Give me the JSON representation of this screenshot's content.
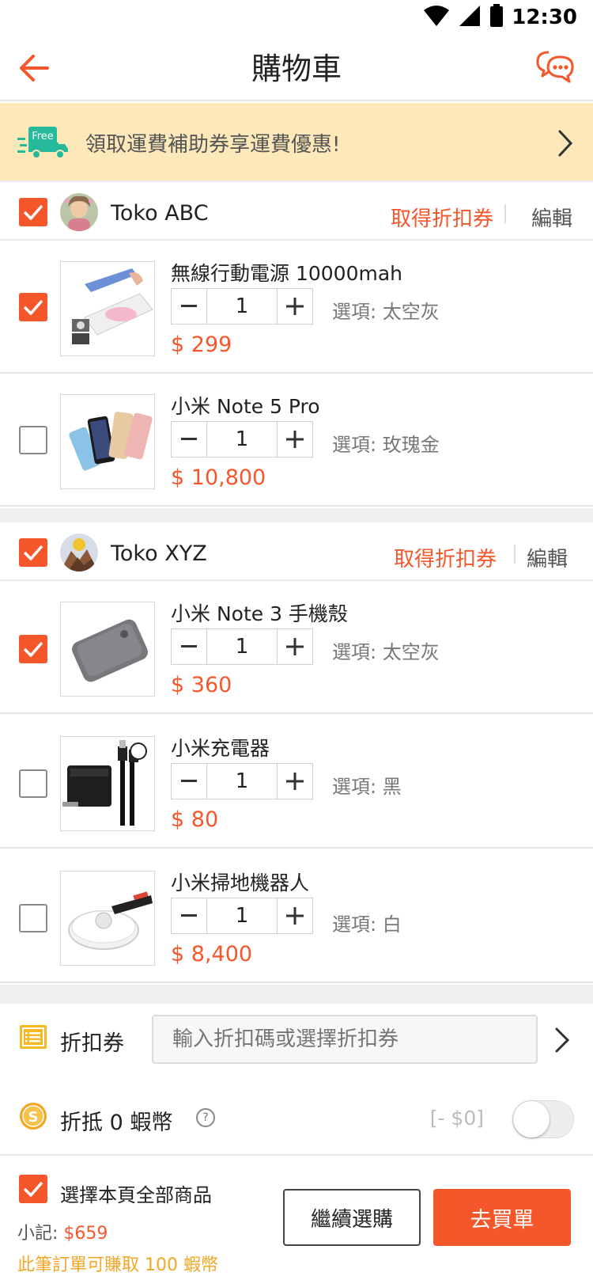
{
  "status_bar": {
    "time": "12:30"
  },
  "header": {
    "title": "購物車"
  },
  "promo": {
    "badge": "Free",
    "text": "領取運費補助券享運費優惠!"
  },
  "shops": [
    {
      "name": "Toko ABC",
      "coupon_label": "取得折扣券",
      "edit_label": "編輯",
      "checked": true,
      "items": [
        {
          "name": "無線行動電源 10000mah",
          "qty": "1",
          "option": "選項: 太空灰",
          "price": "$ 299",
          "checked": true
        },
        {
          "name": "小米 Note 5 Pro",
          "qty": "1",
          "option": "選項: 玫瑰金",
          "price": "$ 10,800",
          "checked": false
        }
      ]
    },
    {
      "name": "Toko XYZ",
      "coupon_label": "取得折扣券",
      "edit_label": "編輯",
      "checked": true,
      "items": [
        {
          "name": "小米 Note 3 手機殼",
          "qty": "1",
          "option": "選項: 太空灰",
          "price": "$ 360",
          "checked": true
        },
        {
          "name": "小米充電器",
          "qty": "1",
          "option": "選項: 黑",
          "price": "$ 80",
          "checked": false
        },
        {
          "name": "小米掃地機器人",
          "qty": "1",
          "option": "選項: 白",
          "price": "$ 8,400",
          "checked": false
        }
      ]
    }
  ],
  "voucher": {
    "label": "折扣券",
    "placeholder": "輸入折扣碼或選擇折扣券"
  },
  "coins": {
    "label": "折抵 0 蝦幣",
    "help": "?",
    "value": "[- $0]",
    "toggle_on": false
  },
  "footer": {
    "select_all_label": "選擇本頁全部商品",
    "subtotal_label": "小記:",
    "subtotal_value": "$659",
    "earn_text": "此筆訂單可賺取 100 蝦幣",
    "continue_label": "繼續選購",
    "checkout_label": "去買單"
  },
  "colors": {
    "accent": "#f5562a",
    "promo_bg": "#fde8b9",
    "coin": "#f5a623"
  }
}
